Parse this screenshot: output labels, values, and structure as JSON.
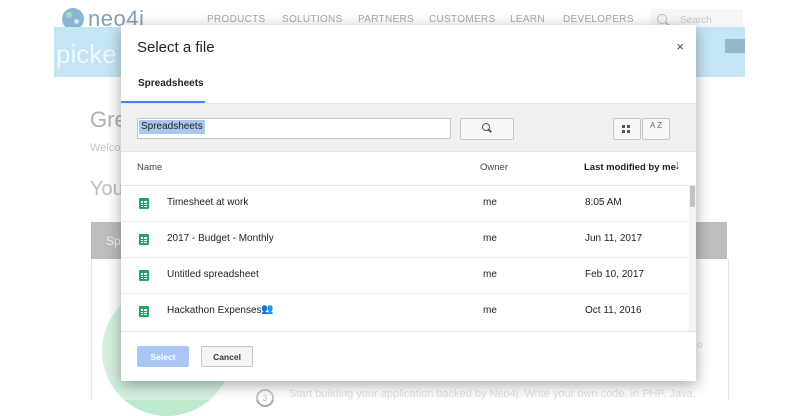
{
  "site": {
    "logo_text": "neo4j",
    "nav": [
      "PRODUCTS",
      "SOLUTIONS",
      "PARTNERS",
      "CUSTOMERS",
      "LEARN",
      "DEVELOPERS"
    ],
    "search_placeholder": "Search",
    "banner_text": "picke",
    "page_title": "Gre",
    "page_subtitle": "Welco",
    "section_title": "You",
    "grey_band_text": "Sp",
    "step_number": "3",
    "step_text": "Start building your application backed by Neo4j. Write your own code, in PHP, Java,",
    "aside_text": "o"
  },
  "dialog": {
    "title": "Select a file",
    "close_glyph": "×",
    "tab": "Spreadsheets",
    "search_value": "Spreadsheets",
    "columns": {
      "name": "Name",
      "owner": "Owner",
      "modified": "Last modified by me",
      "sort_glyph": "↓"
    },
    "files": [
      {
        "name": "Timesheet at work",
        "owner": "me",
        "modified": "8:05 AM",
        "shared": false
      },
      {
        "name": "2017 - Budget - Monthly",
        "owner": "me",
        "modified": "Jun 11, 2017",
        "shared": false
      },
      {
        "name": "Untitled spreadsheet",
        "owner": "me",
        "modified": "Feb 10, 2017",
        "shared": false
      },
      {
        "name": "Hackathon Expenses",
        "owner": "me",
        "modified": "Oct 11, 2016",
        "shared": true
      }
    ],
    "buttons": {
      "select": "Select",
      "cancel": "Cancel"
    },
    "sort_icon_text": "A Z",
    "shared_glyph": "👥",
    "colors": {
      "accent": "#4285f4",
      "sheet_green": "#21a464",
      "select_disabled": "#a9c6f5"
    }
  }
}
